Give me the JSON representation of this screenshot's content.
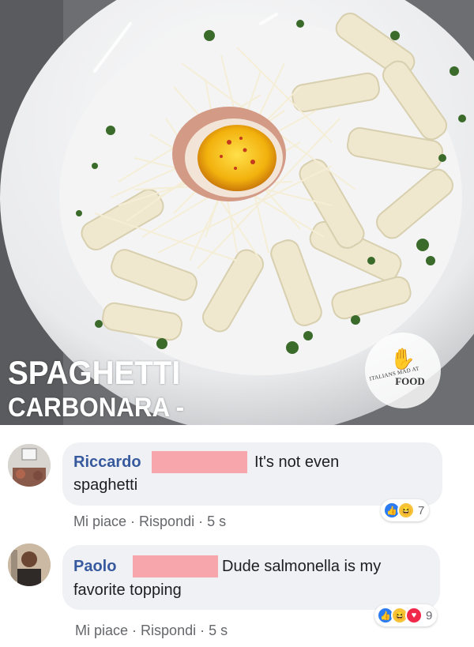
{
  "post_image": {
    "title_line1": "SPAGHETTI",
    "title_line2": "CARBONARA -",
    "logo_small_text": "ITALIANS MAD AT",
    "logo_big_text": "FOOD"
  },
  "comments": [
    {
      "author": "Riccardo",
      "text_line1": "It's not even",
      "text_line2": "spaghetti",
      "like_label": "Mi piace",
      "separator": "·",
      "reply_label": "Rispondi",
      "time": "5 s",
      "reactions": [
        "like-icon",
        "haha-icon"
      ],
      "reaction_count": "7"
    },
    {
      "author": "Paolo",
      "text_line1": "Dude salmonella is my",
      "text_line2": "favorite topping",
      "like_label": "Mi piace",
      "separator": "·",
      "reply_label": "Rispondi",
      "time": "5 s",
      "reactions": [
        "like-icon",
        "haha-icon",
        "love-icon"
      ],
      "reaction_count": "9"
    }
  ],
  "colors": {
    "author_name": "#375a9e",
    "bubble": "#eff1f5",
    "redaction": "#f7a7ab",
    "meta_text": "#65676b"
  }
}
